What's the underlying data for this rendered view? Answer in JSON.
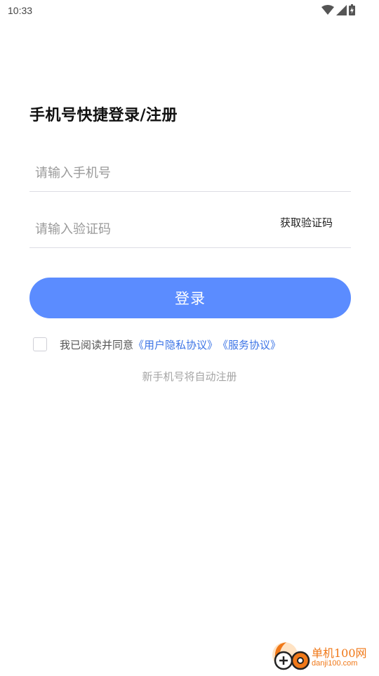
{
  "status_bar": {
    "time": "10:33",
    "icons": [
      "wifi-icon",
      "signal-icon",
      "battery-icon"
    ]
  },
  "login": {
    "title": "手机号快捷登录/注册",
    "phone_placeholder": "请输入手机号",
    "code_placeholder": "请输入验证码",
    "get_code_label": "获取验证码",
    "login_button_label": "登录",
    "agreement_prefix": "我已阅读并同意",
    "privacy_link": "《用户隐私协议》",
    "service_link": "《服务协议》",
    "agreement_checked": false,
    "auto_register_note": "新手机号将自动注册"
  },
  "watermark": {
    "name": "单机100网",
    "url": "danji100.com"
  },
  "colors": {
    "accent": "#5b8cff",
    "link": "#3c74e6",
    "watermark": "#f07818"
  }
}
